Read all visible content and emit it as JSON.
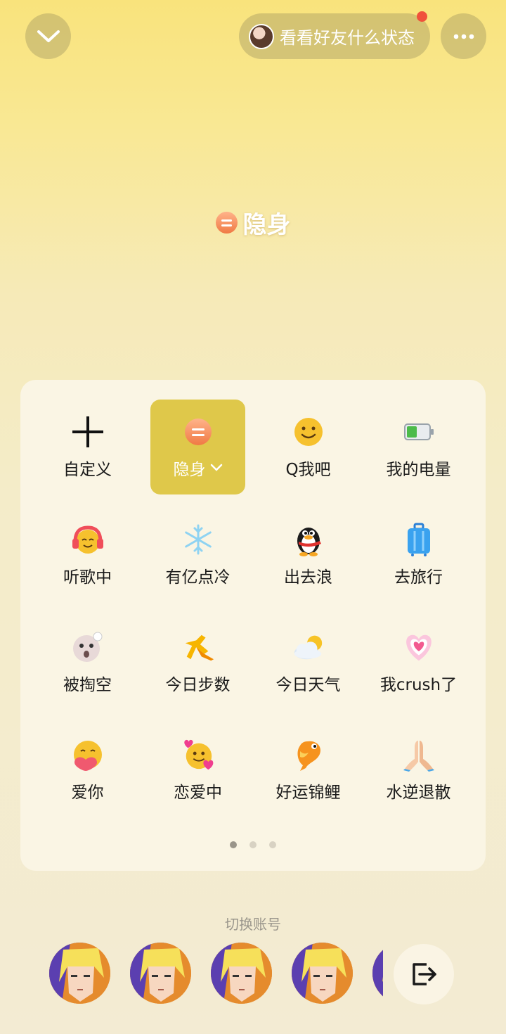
{
  "header": {
    "friend_prompt": "看看好友什么状态",
    "has_notification": true
  },
  "current_status": {
    "label": "隐身",
    "icon": "invisible-status-icon"
  },
  "status_grid": {
    "items": [
      {
        "label": "自定义",
        "icon": "plus-icon"
      },
      {
        "label": "隐身",
        "icon": "invisible-status-icon",
        "selected": true
      },
      {
        "label": "Q我吧",
        "icon": "smiley-face-icon"
      },
      {
        "label": "我的电量",
        "icon": "battery-icon"
      },
      {
        "label": "听歌中",
        "icon": "headphones-face-icon"
      },
      {
        "label": "有亿点冷",
        "icon": "snowflake-icon"
      },
      {
        "label": "出去浪",
        "icon": "penguin-icon"
      },
      {
        "label": "去旅行",
        "icon": "suitcase-icon"
      },
      {
        "label": "被掏空",
        "icon": "exhausted-face-icon"
      },
      {
        "label": "今日步数",
        "icon": "running-icon"
      },
      {
        "label": "今日天气",
        "icon": "cloud-sun-icon"
      },
      {
        "label": "我crush了",
        "icon": "heart-icon"
      },
      {
        "label": "爱你",
        "icon": "hugging-face-icon"
      },
      {
        "label": "恋爱中",
        "icon": "in-love-face-icon"
      },
      {
        "label": "好运锦鲤",
        "icon": "koi-fish-icon"
      },
      {
        "label": "水逆退散",
        "icon": "praying-hands-icon"
      }
    ],
    "page_count": 3,
    "current_page": 1
  },
  "accounts": {
    "label": "切换账号",
    "count_visible": 5
  },
  "colors": {
    "selected_cell": "#dfc84a",
    "notification_dot": "#f0513b",
    "panel_bg": "#faf5e4"
  }
}
